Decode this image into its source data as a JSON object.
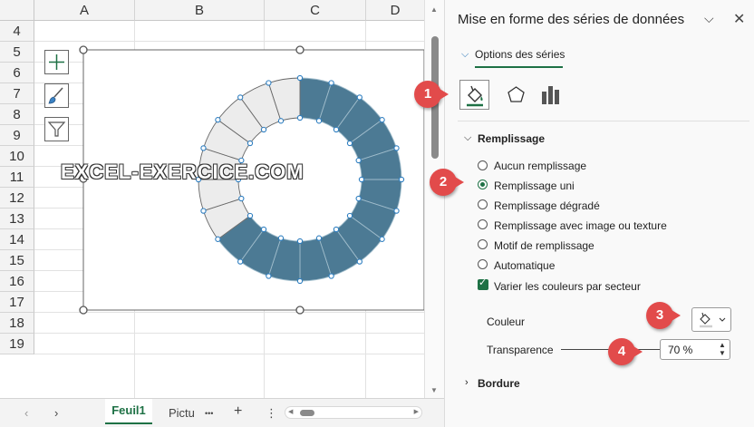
{
  "sheet": {
    "columns": [
      "A",
      "B",
      "C",
      "D"
    ],
    "rows": [
      "4",
      "5",
      "6",
      "7",
      "8",
      "9",
      "10",
      "11",
      "12",
      "13",
      "14",
      "15",
      "16",
      "17",
      "18",
      "19"
    ],
    "tabs": {
      "active": "Feuil1",
      "second": "Pictu",
      "more": "•••",
      "add": "+",
      "menu": "⋮",
      "prev": "‹",
      "next": "›"
    }
  },
  "chart": {
    "watermark": "EXCEL-EXERCICE.COM",
    "tool_icons": [
      "plus-icon",
      "brush-icon",
      "filter-icon"
    ],
    "segments_total": 20,
    "segments_highlighted": 13,
    "color_highlight": "#4c7a94",
    "color_light": "#ececec"
  },
  "pane": {
    "title": "Mise en forme des séries de données",
    "ctrl_dropdown": "⌵",
    "close": "✕",
    "tab_label": "Options des séries",
    "section_fill": "Remplissage",
    "fill_options": [
      {
        "label": "Aucun remplissage",
        "selected": false
      },
      {
        "label": "Remplissage uni",
        "selected": true
      },
      {
        "label": "Remplissage dégradé",
        "selected": false
      },
      {
        "label": "Remplissage avec image ou texture",
        "selected": false
      },
      {
        "label": "Motif de remplissage",
        "selected": false
      },
      {
        "label": "Automatique",
        "selected": false
      }
    ],
    "vary_colors": "Varier les couleurs par secteur",
    "color_label": "Couleur",
    "transparency_label": "Transparence",
    "transparency_value": "70 %",
    "section_border": "Bordure"
  },
  "badges": [
    "1",
    "2",
    "3",
    "4"
  ],
  "colors": {
    "accent": "#1e7145",
    "badge": "#e24b4b"
  }
}
